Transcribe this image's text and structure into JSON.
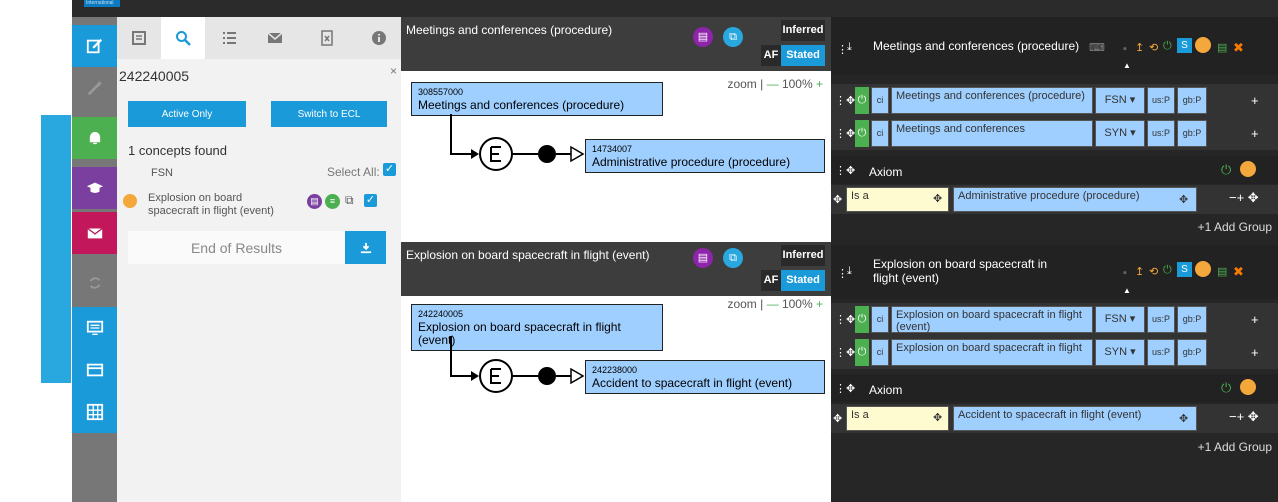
{
  "brand": "International",
  "search": {
    "query": "242240005",
    "close": "×",
    "active_only_label": "Active Only",
    "switch_ecl_label": "Switch to ECL",
    "found_text": "1 concepts found",
    "select_all_label": "Select All:",
    "col_header": "FSN",
    "results": [
      {
        "label": "Explosion on board spacecraft in flight (event)"
      }
    ],
    "end_label": "End of Results"
  },
  "views": [
    {
      "title": "Meetings and conferences (procedure)",
      "inferred": "Inferred",
      "af": "AF",
      "stated": "Stated",
      "zoom_label": "zoom |",
      "zoom_minus": "—",
      "zoom_value": "100%",
      "zoom_plus": "+",
      "focus": {
        "id": "308557000",
        "label": "Meetings and conferences (procedure)"
      },
      "parent": {
        "id": "14734007",
        "label": "Administrative procedure (procedure)"
      }
    },
    {
      "title": "Explosion on board spacecraft in flight (event)",
      "inferred": "Inferred",
      "af": "AF",
      "stated": "Stated",
      "zoom_label": "zoom |",
      "zoom_minus": "—",
      "zoom_value": "100%",
      "zoom_plus": "+",
      "focus": {
        "id": "242240005",
        "label": "Explosion on board spacecraft in flight (event)"
      },
      "parent": {
        "id": "242238000",
        "label": "Accident to spacecraft in flight (event)"
      }
    }
  ],
  "editors": [
    {
      "title": "Meetings and conferences (procedure)",
      "descriptions": [
        {
          "ci": "ci",
          "term": "Meetings and conferences (procedure)",
          "type": "FSN",
          "us": "us:P",
          "gb": "gb:P"
        },
        {
          "ci": "ci",
          "term": "Meetings and conferences",
          "type": "SYN",
          "us": "us:P",
          "gb": "gb:P"
        }
      ],
      "axiom_label": "Axiom",
      "rel_type": "Is a",
      "rel_target": "Administrative procedure (procedure)",
      "add_group": "+1 Add Group"
    },
    {
      "title": "Explosion on board spacecraft in flight (event)",
      "descriptions": [
        {
          "ci": "ci",
          "term": "Explosion on board spacecraft in flight (event)",
          "type": "FSN",
          "us": "us:P",
          "gb": "gb:P"
        },
        {
          "ci": "ci",
          "term": "Explosion on board spacecraft in flight",
          "type": "SYN",
          "us": "us:P",
          "gb": "gb:P"
        }
      ],
      "axiom_label": "Axiom",
      "rel_type": "Is a",
      "rel_target": "Accident to spacecraft in flight (event)",
      "add_group": "+1 Add Group"
    }
  ],
  "colors": {
    "accent": "#1a9ad9",
    "nav_green": "#4caf50",
    "nav_purple": "#7b3fa0",
    "nav_red": "#c2185b",
    "concept": "#9fcfff",
    "orange": "#f4a73b"
  }
}
